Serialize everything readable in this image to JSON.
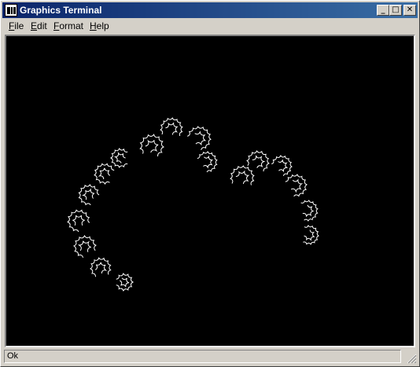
{
  "window": {
    "title": "Graphics Terminal",
    "controls": {
      "minimize": "_",
      "maximize": "□",
      "close": "✕"
    }
  },
  "menu": {
    "items": [
      {
        "label": "File"
      },
      {
        "label": "Edit"
      },
      {
        "label": "Format"
      },
      {
        "label": "Help"
      }
    ]
  },
  "status": {
    "text": "Ok"
  },
  "colors": {
    "canvas_bg": "#000000",
    "drawing": "#ffffff",
    "title_bar": "#0a246a"
  }
}
